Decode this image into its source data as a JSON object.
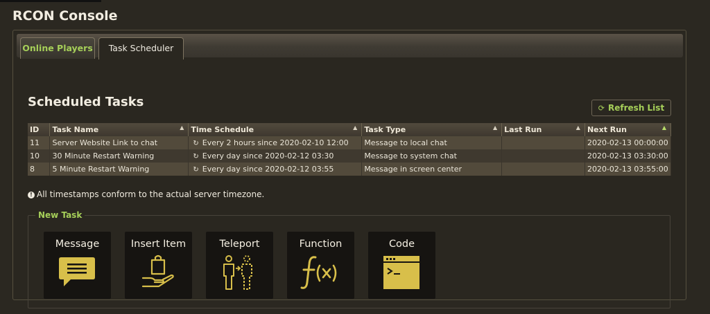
{
  "app": {
    "title": "RCON Console"
  },
  "tabs": [
    {
      "label": "Online Players"
    },
    {
      "label": "Task Scheduler"
    }
  ],
  "section": {
    "title": "Scheduled Tasks"
  },
  "refresh_button": {
    "icon": "refresh-icon",
    "label": "Refresh List"
  },
  "table": {
    "headers": [
      "ID",
      "Task Name",
      "Time Schedule",
      "Task Type",
      "Last Run",
      "Next Run"
    ],
    "rows": [
      {
        "id": "11",
        "name": "Server Website Link to chat",
        "schedule": "Every 2 hours since 2020-02-10 12:00",
        "type": "Message to local chat",
        "last_run": "",
        "next_run": "2020-02-13 00:00:00"
      },
      {
        "id": "10",
        "name": "30 Minute Restart Warning",
        "schedule": "Every day since 2020-02-12 03:30",
        "type": "Message to system chat",
        "last_run": "",
        "next_run": "2020-02-13 03:30:00"
      },
      {
        "id": "8",
        "name": "5 Minute Restart Warning",
        "schedule": "Every day since 2020-02-12 03:55",
        "type": "Message in screen center",
        "last_run": "",
        "next_run": "2020-02-13 03:55:00"
      }
    ]
  },
  "note": {
    "icon": "info-icon",
    "text": "All timestamps conform to the actual server timezone."
  },
  "new_task": {
    "legend": "New Task",
    "tiles": [
      {
        "label": "Message",
        "icon": "message-icon"
      },
      {
        "label": "Insert Item",
        "icon": "insert-item-icon"
      },
      {
        "label": "Teleport",
        "icon": "teleport-icon"
      },
      {
        "label": "Function",
        "icon": "function-icon"
      },
      {
        "label": "Code",
        "icon": "code-icon"
      }
    ]
  },
  "colors": {
    "accent": "#a6cf59",
    "icon_gold": "#d8bf4a",
    "background": "#2b2821"
  }
}
